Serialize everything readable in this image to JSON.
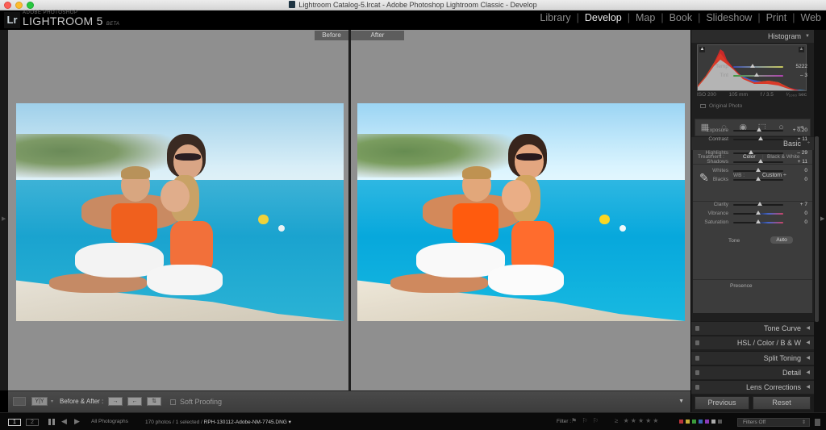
{
  "window": {
    "title": "Lightroom Catalog-5.lrcat - Adobe Photoshop Lightroom Classic - Develop"
  },
  "brand": {
    "small": "ADOBE PHOTOSHOP",
    "name": "LIGHTROOM 5",
    "badge": "Lr",
    "beta": "BETA"
  },
  "modules": [
    {
      "label": "Library",
      "active": false
    },
    {
      "label": "Develop",
      "active": true
    },
    {
      "label": "Map",
      "active": false
    },
    {
      "label": "Book",
      "active": false
    },
    {
      "label": "Slideshow",
      "active": false
    },
    {
      "label": "Print",
      "active": false
    },
    {
      "label": "Web",
      "active": false
    }
  ],
  "compare": {
    "before_label": "Before",
    "after_label": "After"
  },
  "toolbar": {
    "yy_label": "Y|Y",
    "before_after_label": "Before & After :",
    "soft_proofing_label": "Soft Proofing",
    "soft_proofing_checked": false
  },
  "histogram": {
    "header": "Histogram",
    "iso": "ISO 200",
    "focal": "105 mm",
    "aperture": "f / 3.5",
    "shutter": "¹⁄₁₀₀₀ sec",
    "original_photo_label": "Original Photo"
  },
  "basic": {
    "header": "Basic",
    "treatment_label": "Treatment :",
    "treatment_color": "Color",
    "treatment_bw": "Black & White",
    "wb_label": "WB :",
    "wb_value": "Custom ÷",
    "tone_label": "Tone",
    "auto_label": "Auto",
    "presence_label": "Presence",
    "sliders": [
      {
        "name": "Temp",
        "value": "5222",
        "pos": 0.38
      },
      {
        "name": "Tint",
        "value": "– 3",
        "pos": 0.47
      },
      {
        "name": "Exposure",
        "value": "+ 0.20",
        "pos": 0.52
      },
      {
        "name": "Contrast",
        "value": "+ 11",
        "pos": 0.55
      },
      {
        "name": "Highlights",
        "value": "– 29",
        "pos": 0.36
      },
      {
        "name": "Shadows",
        "value": "+ 11",
        "pos": 0.55
      },
      {
        "name": "Whites",
        "value": "0",
        "pos": 0.5
      },
      {
        "name": "Blacks",
        "value": "0",
        "pos": 0.5
      },
      {
        "name": "Clarity",
        "value": "+ 7",
        "pos": 0.53
      },
      {
        "name": "Vibrance",
        "value": "0",
        "pos": 0.5
      },
      {
        "name": "Saturation",
        "value": "0",
        "pos": 0.5
      }
    ]
  },
  "collapsed_panels": [
    {
      "label": "Tone Curve"
    },
    {
      "label": "HSL / Color / B & W"
    },
    {
      "label": "Split Toning"
    },
    {
      "label": "Detail"
    },
    {
      "label": "Lens Corrections"
    }
  ],
  "buttons": {
    "previous": "Previous",
    "reset": "Reset"
  },
  "filmstrip": {
    "view1": "1",
    "view2": "2",
    "source": "All Photographs",
    "count": "170 photos / 1 selected /",
    "filename": "RPH-130112-Adobe-NM-7745.DNG ▾",
    "filter_label": "Filter :",
    "flags": "⚑ ⚐ ⚐",
    "stars": "≥ ★★★★★",
    "filters_value": "Filters Off",
    "color_labels": [
      "#b8343a",
      "#c9b13a",
      "#3a9a3a",
      "#3a66b8",
      "#8a3ab8",
      "#aaaaaa",
      "#555555"
    ]
  }
}
